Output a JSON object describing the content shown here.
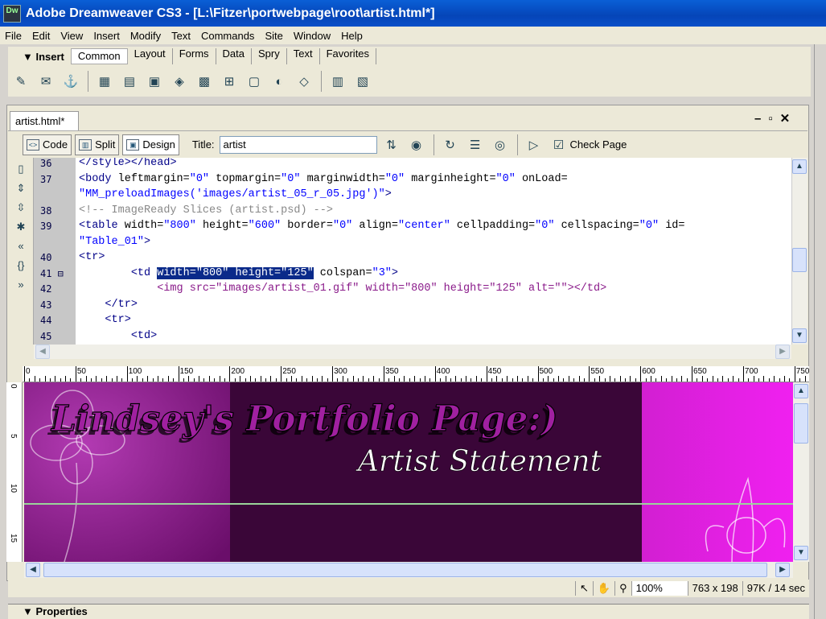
{
  "window": {
    "title": "Adobe Dreamweaver CS3 - [L:\\Fitzer\\portwebpage\\root\\artist.html*]",
    "app_icon": "Dw"
  },
  "menu": [
    "File",
    "Edit",
    "View",
    "Insert",
    "Modify",
    "Text",
    "Commands",
    "Site",
    "Window",
    "Help"
  ],
  "insert": {
    "label": "▼ Insert",
    "tabs": [
      "Common",
      "Layout",
      "Forms",
      "Data",
      "Spry",
      "Text",
      "Favorites"
    ]
  },
  "document": {
    "tab": "artist.html*",
    "view_code": "Code",
    "view_split": "Split",
    "view_design": "Design",
    "title_label": "Title:",
    "title_value": "artist",
    "check_page": "Check Page"
  },
  "code_lines": [
    {
      "n": "36",
      "text": "</style></head>"
    },
    {
      "n": "37",
      "text": "<body leftmargin=\"0\" topmargin=\"0\" marginwidth=\"0\" marginheight=\"0\" onLoad="
    },
    {
      "n": "",
      "text": "\"MM_preloadImages('images/artist_05_r_05.jpg')\">"
    },
    {
      "n": "38",
      "text": "<!-- ImageReady Slices (artist.psd) -->"
    },
    {
      "n": "39",
      "text": "<table width=\"800\" height=\"600\" border=\"0\" align=\"center\" cellpadding=\"0\" cellspacing=\"0\" id="
    },
    {
      "n": "",
      "text": "\"Table_01\">"
    },
    {
      "n": "40",
      "text": "<tr>"
    },
    {
      "n": "41",
      "pre": "        <td ",
      "sel": "width=\"800\" height=\"125\"",
      "post": " colspan=\"3\">"
    },
    {
      "n": "42",
      "text": "            <img src=\"images/artist_01.gif\" width=\"800\" height=\"125\" alt=\"\"></td>"
    },
    {
      "n": "43",
      "text": "    </tr>"
    },
    {
      "n": "44",
      "text": "    <tr>"
    },
    {
      "n": "45",
      "text": "        <td>"
    }
  ],
  "ruler": [
    "0",
    "50",
    "100",
    "150",
    "200",
    "250",
    "300",
    "350",
    "400",
    "450",
    "500",
    "550",
    "600",
    "650",
    "700",
    "750"
  ],
  "vruler": [
    "0",
    "5",
    "10",
    "15"
  ],
  "banner": {
    "title": "Lindsey's Portfolio Page:)",
    "subtitle": "Artist Statement"
  },
  "status": {
    "zoom": "100%",
    "dimensions": "763 x 198",
    "size": "97K / 14 sec"
  },
  "properties": "▼ Properties"
}
